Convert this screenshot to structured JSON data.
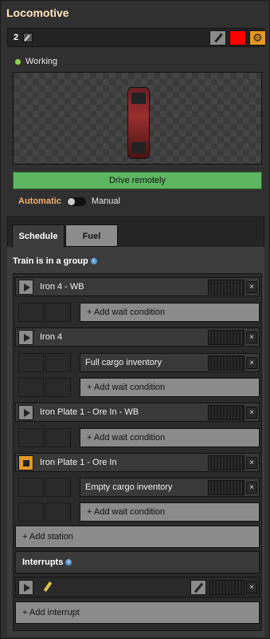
{
  "window": {
    "title": "Locomotive"
  },
  "topbar": {
    "number": "2"
  },
  "status": {
    "text": "Working"
  },
  "drive": {
    "label": "Drive remotely"
  },
  "mode": {
    "automatic": "Automatic",
    "manual": "Manual"
  },
  "tabs": [
    {
      "label": "Schedule"
    },
    {
      "label": "Fuel"
    }
  ],
  "schedule": {
    "group_title": "Train is in a group",
    "stations": [
      {
        "name": "Iron 4 - WB",
        "conditions": [],
        "add_wait": "+ Add wait condition"
      },
      {
        "name": "Iron 4",
        "conditions": [
          "Full cargo inventory"
        ],
        "add_wait": "+ Add wait condition"
      },
      {
        "name": "Iron Plate 1 - Ore In - WB",
        "conditions": [],
        "add_wait": "+ Add wait condition"
      },
      {
        "name": "Iron Plate 1 - Ore In",
        "conditions": [
          "Empty cargo inventory"
        ],
        "add_wait": "+ Add wait condition"
      }
    ],
    "add_station": "+ Add station",
    "interrupts_title": "Interrupts",
    "add_interrupt": "+ Add interrupt",
    "close_glyph": "×"
  },
  "colors": {
    "train_color": "#ff0000",
    "accent": "#e39827",
    "drive_green": "#5eb663"
  }
}
